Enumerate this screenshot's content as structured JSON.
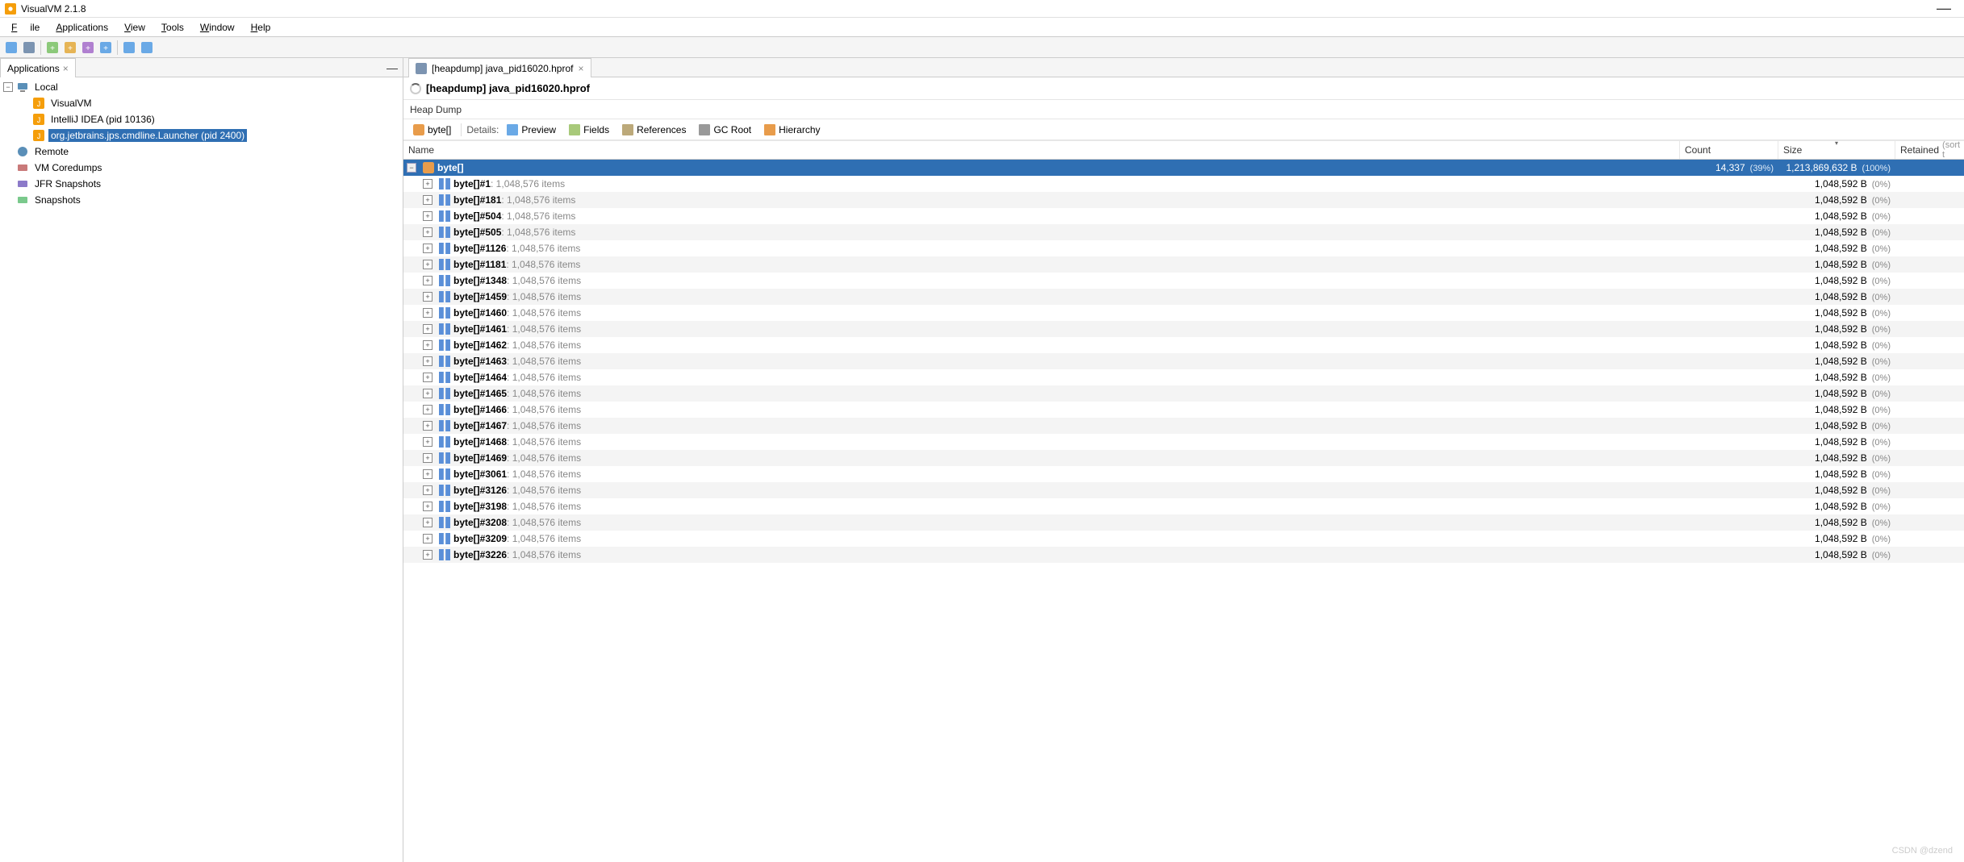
{
  "window": {
    "title": "VisualVM 2.1.8"
  },
  "menu": {
    "items": [
      "File",
      "Applications",
      "View",
      "Tools",
      "Window",
      "Help"
    ]
  },
  "leftPanel": {
    "tab": "Applications",
    "nodes": [
      {
        "label": "Local",
        "depth": 0,
        "icon": "computer",
        "expanded": true
      },
      {
        "label": "VisualVM",
        "depth": 1,
        "icon": "java-app"
      },
      {
        "label": "IntelliJ IDEA (pid 10136)",
        "depth": 1,
        "icon": "java-app"
      },
      {
        "label": "org.jetbrains.jps.cmdline.Launcher (pid 2400)",
        "depth": 1,
        "icon": "java-app",
        "selected": true
      },
      {
        "label": "Remote",
        "depth": 0,
        "icon": "remote"
      },
      {
        "label": "VM Coredumps",
        "depth": 0,
        "icon": "coredump"
      },
      {
        "label": "JFR Snapshots",
        "depth": 0,
        "icon": "jfr"
      },
      {
        "label": "Snapshots",
        "depth": 0,
        "icon": "snapshot"
      }
    ]
  },
  "rightPanel": {
    "tabLabel": "[heapdump] java_pid16020.hprof",
    "docTitle": "[heapdump] java_pid16020.hprof",
    "subHeader": "Heap Dump",
    "detailChips": {
      "arrayLabel": "byte[]",
      "detailsLabel": "Details:",
      "items": [
        "Preview",
        "Fields",
        "References",
        "GC Root",
        "Hierarchy"
      ]
    },
    "columns": {
      "name": "Name",
      "count": "Count",
      "size": "Size",
      "retained": "Retained",
      "retainedSort": "(sort t"
    },
    "parentRow": {
      "name": "byte[]",
      "count": "14,337",
      "countPct": "(39%)",
      "size": "1,213,869,632 B",
      "sizePct": "(100%)"
    },
    "rowSuffix": " : 1,048,576 items",
    "rowSize": "1,048,592 B",
    "rowPct": "(0%)",
    "rows": [
      "byte[]#1",
      "byte[]#181",
      "byte[]#504",
      "byte[]#505",
      "byte[]#1126",
      "byte[]#1181",
      "byte[]#1348",
      "byte[]#1459",
      "byte[]#1460",
      "byte[]#1461",
      "byte[]#1462",
      "byte[]#1463",
      "byte[]#1464",
      "byte[]#1465",
      "byte[]#1466",
      "byte[]#1467",
      "byte[]#1468",
      "byte[]#1469",
      "byte[]#3061",
      "byte[]#3126",
      "byte[]#3198",
      "byte[]#3208",
      "byte[]#3209",
      "byte[]#3226"
    ]
  },
  "watermark": "CSDN @dzend"
}
